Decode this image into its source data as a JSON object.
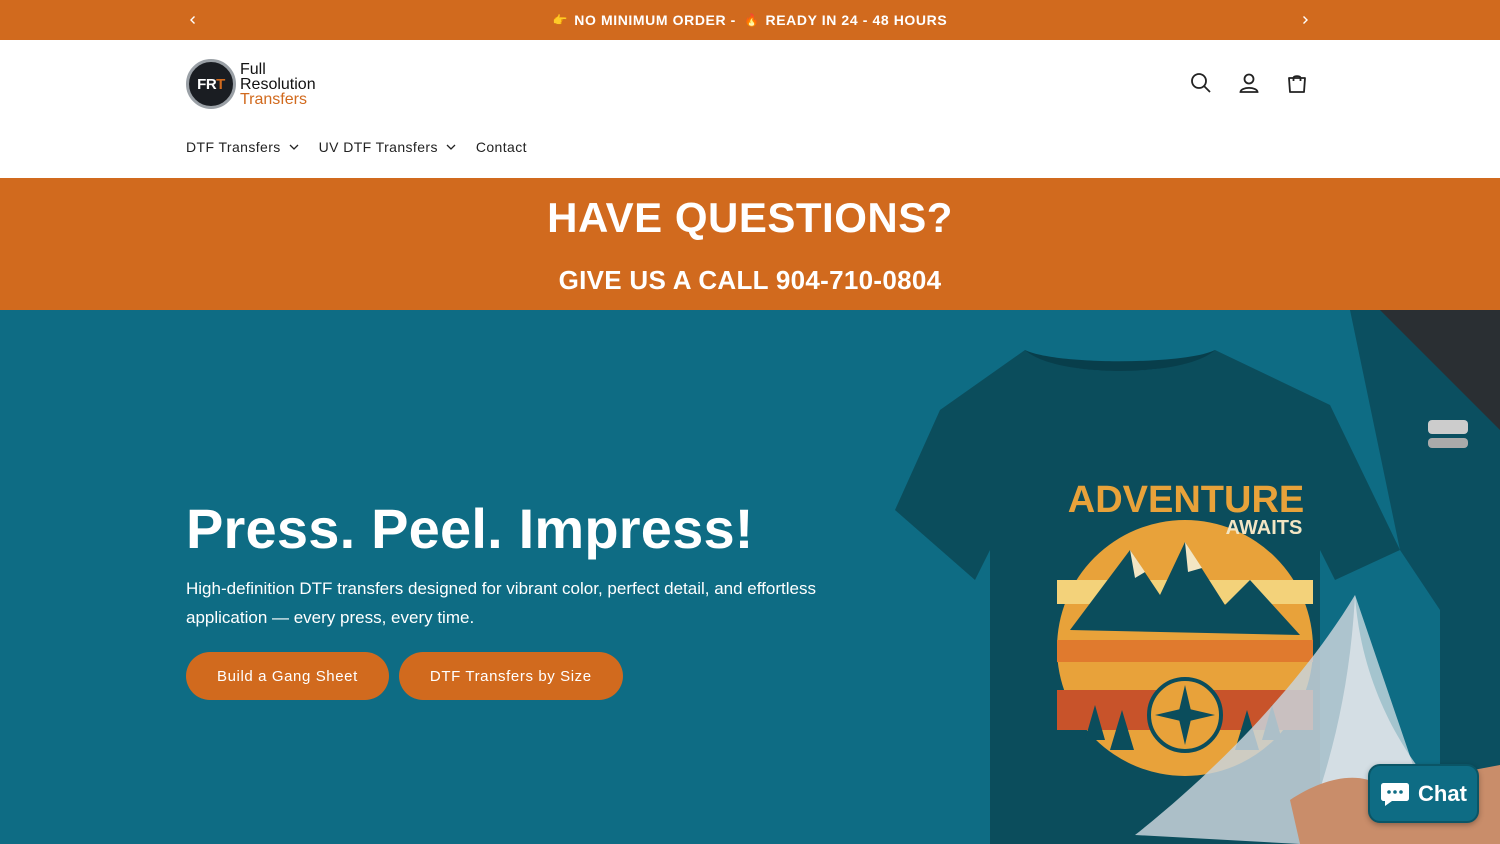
{
  "colors": {
    "brand_orange": "#D16A1E",
    "hero_teal": "#0E6C84",
    "white": "#FFFFFF"
  },
  "announcement": {
    "emoji_1": "👉",
    "text_1": "NO MINIMUM ORDER -",
    "emoji_2": "🔥",
    "text_2": "READY IN 24 - 48 HOURS",
    "prev_icon": "chevron-left-icon",
    "next_icon": "chevron-right-icon"
  },
  "logo": {
    "mark_f": "FR",
    "mark_t": "T",
    "line1": "Full",
    "line2": "Resolution",
    "line3": "Transfers"
  },
  "header_icons": [
    "search-icon",
    "account-icon",
    "cart-icon"
  ],
  "nav": [
    {
      "label": "DTF Transfers",
      "has_dropdown": true
    },
    {
      "label": "UV DTF Transfers",
      "has_dropdown": true
    },
    {
      "label": "Contact",
      "has_dropdown": false
    }
  ],
  "questions": {
    "title": "HAVE QUESTIONS?",
    "subtitle": "GIVE US A CALL 904-710-0804"
  },
  "hero": {
    "title": "Press. Peel. Impress!",
    "subtitle": "High-definition DTF transfers designed for vibrant color, perfect detail, and effortless application — every press, every time.",
    "buttons": [
      "Build a Gang Sheet",
      "DTF Transfers by Size"
    ],
    "shirt_text_1": "ADVENTURE",
    "shirt_text_2": "AWAITS"
  },
  "chat": {
    "label": "Chat"
  }
}
